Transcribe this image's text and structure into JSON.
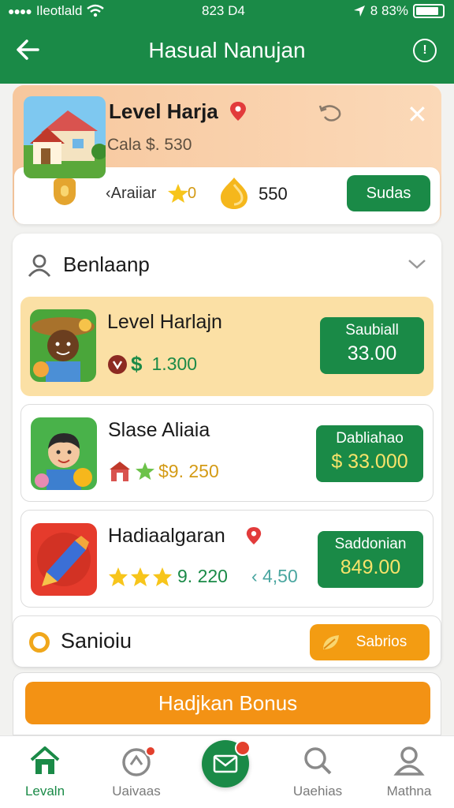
{
  "status_bar": {
    "carrier": "Ileotlald",
    "time": "823 D4",
    "battery": "8 83%"
  },
  "header": {
    "title": "Hasual Nanujan"
  },
  "hero": {
    "name": "Level Harja",
    "subtitle": "Cala $. 530",
    "tag": "‹Araiiar",
    "star_value": "0",
    "coin_value": "550",
    "button_label": "Sudas"
  },
  "section": {
    "title": "Benlaanp"
  },
  "items": [
    {
      "name": "Level Harlajn",
      "currency": "$",
      "value": "1.300",
      "button_label": "Saubiall",
      "button_amount": "33.00"
    },
    {
      "name": "Slase Aliaia",
      "value": "$9. 250",
      "button_label": "Dabliahao",
      "button_amount": "$ 33.000"
    },
    {
      "name": "Hadiaalgaran",
      "value": "9. 220",
      "extra": "‹ 4,50",
      "button_label": "Saddonian",
      "button_amount": "849.00"
    }
  ],
  "section2": {
    "title": "Sanioiu",
    "button_label": "Sabrios"
  },
  "bonus_button": "Hadjkan Bonus",
  "tabs": [
    {
      "label": "Levaln",
      "icon": "home-icon"
    },
    {
      "label": "Uaivaas",
      "icon": "coin-icon"
    },
    {
      "label": "",
      "icon": "mail-icon"
    },
    {
      "label": "Uaehias",
      "icon": "search-icon"
    },
    {
      "label": "Mathna",
      "icon": "profile-icon"
    }
  ],
  "colors": {
    "brand_green": "#1a8a47",
    "accent_orange": "#f39214",
    "highlight_yellow": "#fbe0a5",
    "hero_peach": "#f7c79d"
  }
}
